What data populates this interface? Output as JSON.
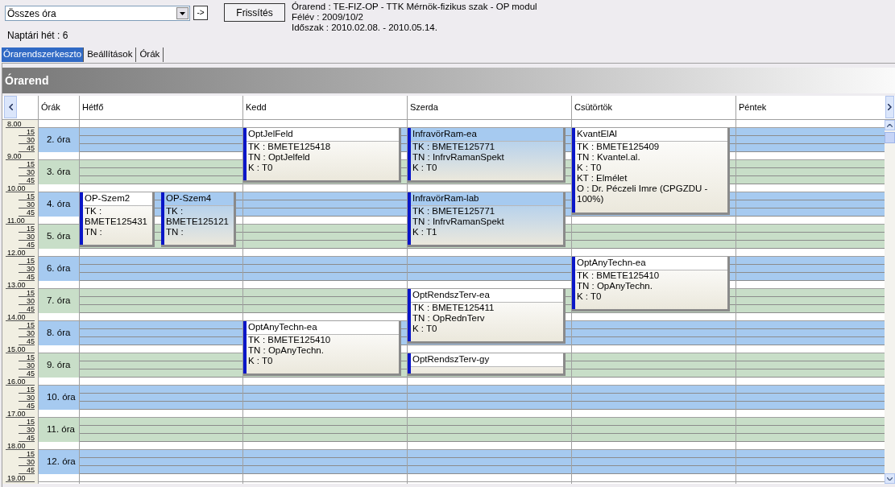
{
  "toolbar": {
    "filter": {
      "value": "Összes óra"
    },
    "go_button": "->",
    "refresh_button": "Frissítés",
    "week": "Naptári hét : 6",
    "info": [
      "Órarend : TE-FIZ-OP - TTK Mérnök-fizikus szak - OP modul",
      "Félév : 2009/10/2",
      "Időszak : 2010.02.08. - 2010.05.14."
    ]
  },
  "tabs": [
    {
      "label": "Órarendszerkeszto",
      "selected": true
    },
    {
      "label": "Beállítások",
      "selected": false
    },
    {
      "label": "Órák",
      "selected": false
    }
  ],
  "section_title": "Órarend",
  "columns": [
    "Órák",
    "Hétfő",
    "Kedd",
    "Szerda",
    "Csütörtök",
    "Péntek"
  ],
  "periods": [
    {
      "label": "2. óra",
      "hour": "8.00",
      "quarters": [
        "15",
        "30",
        "45"
      ],
      "color": "#a6caf0",
      "cells": [
        {},
        {
          "events": [
            {
              "title": "OptJelFeld",
              "lines": [
                "TK : BMETE125418",
                "TN : OptJelfeld",
                "K : T0"
              ],
              "kind": "double",
              "highlighted": false
            }
          ]
        },
        {
          "events": [
            {
              "title": "InfravörRam-ea",
              "lines": [
                "TK : BMETE125771",
                "TN : InfrvRamanSpekt",
                "K : T0"
              ],
              "kind": "double",
              "highlighted": true
            }
          ]
        },
        {
          "events": [
            {
              "title": "KvantElAl",
              "lines": [
                "TK : BMETE125409",
                "TN : Kvantel.al.",
                "K : T0",
                "KT : Elmélet",
                "O :  Dr. Péczeli Imre (CPGZDU - 100%)"
              ],
              "kind": "triple",
              "highlighted": false
            }
          ]
        },
        {}
      ]
    },
    {
      "label": "3. óra",
      "hour": "9.00",
      "quarters": [
        "15",
        "30",
        "45"
      ],
      "color": "#c8dec8",
      "cells": [
        {},
        {},
        {},
        {},
        {}
      ]
    },
    {
      "label": "4. óra",
      "hour": "10.00",
      "quarters": [
        "15",
        "30",
        "45"
      ],
      "color": "#a6caf0",
      "cells": [
        {
          "events": [
            {
              "title": "OP-Szem2",
              "lines": [
                "TK :",
                "BMETE125431",
                "TN :"
              ],
              "kind": "double",
              "highlighted": false
            },
            {
              "title": "OP-Szem4",
              "lines": [
                "TK :",
                "BMETE125121",
                "TN :"
              ],
              "kind": "double",
              "highlighted": true
            }
          ]
        },
        {},
        {
          "events": [
            {
              "title": "InfravörRam-lab",
              "lines": [
                "TK : BMETE125771",
                "TN : InfrvRamanSpekt",
                "K : T1"
              ],
              "kind": "double",
              "highlighted": true
            }
          ]
        },
        {},
        {}
      ]
    },
    {
      "label": "5. óra",
      "hour": "11.00",
      "quarters": [
        "15",
        "30",
        "45"
      ],
      "color": "#c8dec8",
      "cells": [
        {},
        {},
        {},
        {},
        {}
      ]
    },
    {
      "label": "6. óra",
      "hour": "12.00",
      "quarters": [
        "15",
        "30",
        "45"
      ],
      "color": "#a6caf0",
      "cells": [
        {},
        {},
        {},
        {
          "events": [
            {
              "title": "OptAnyTechn-ea",
              "lines": [
                "TK : BMETE125410",
                "TN : OpAnyTechn.",
                "K : T0"
              ],
              "kind": "double",
              "highlighted": false
            }
          ]
        },
        {}
      ]
    },
    {
      "label": "7. óra",
      "hour": "13.00",
      "quarters": [
        "15",
        "30",
        "45"
      ],
      "color": "#c8dec8",
      "cells": [
        {},
        {},
        {
          "events": [
            {
              "title": "OptRendszTerv-ea",
              "lines": [
                "TK : BMETE125411",
                "TN : OpRednTerv",
                "K : T0"
              ],
              "kind": "double",
              "highlighted": false
            }
          ]
        },
        {},
        {}
      ]
    },
    {
      "label": "8. óra",
      "hour": "14.00",
      "quarters": [
        "15",
        "30",
        "45"
      ],
      "color": "#a6caf0",
      "cells": [
        {},
        {
          "events": [
            {
              "title": "OptAnyTechn-ea",
              "lines": [
                "TK : BMETE125410",
                "TN : OpAnyTechn.",
                "K : T0"
              ],
              "kind": "double",
              "highlighted": false
            }
          ]
        },
        {},
        {},
        {}
      ]
    },
    {
      "label": "9. óra",
      "hour": "15.00",
      "quarters": [
        "15",
        "30",
        "45"
      ],
      "color": "#c8dec8",
      "cells": [
        {},
        {},
        {
          "events": [
            {
              "title": "OptRendszTerv-gy",
              "kind": "single",
              "highlighted": false
            }
          ]
        },
        {},
        {}
      ]
    },
    {
      "label": "10. óra",
      "hour": "16.00",
      "quarters": [
        "15",
        "30",
        "45"
      ],
      "color": "#a6caf0",
      "cells": [
        {},
        {},
        {},
        {},
        {}
      ]
    },
    {
      "label": "11. óra",
      "hour": "17.00",
      "quarters": [
        "15",
        "30",
        "45"
      ],
      "color": "#c8dec8",
      "cells": [
        {},
        {},
        {},
        {},
        {}
      ]
    },
    {
      "label": "12. óra",
      "hour": "18.00",
      "quarters": [
        "15",
        "30",
        "45"
      ],
      "color": "#a6caf0",
      "cells": [
        {},
        {},
        {},
        {},
        {}
      ]
    }
  ],
  "end_hour": "19.00"
}
